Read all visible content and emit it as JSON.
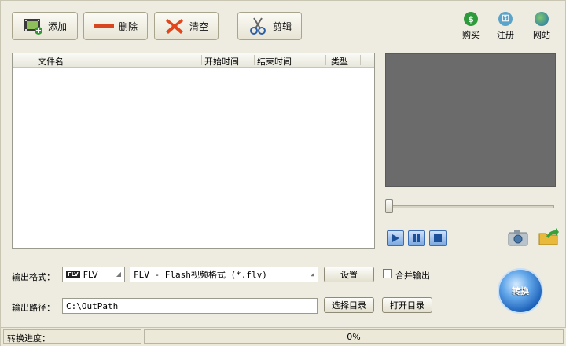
{
  "toolbar": {
    "add_label": "添加",
    "delete_label": "删除",
    "clear_label": "清空",
    "clip_label": "剪辑"
  },
  "top_right": {
    "buy_label": "购买",
    "register_label": "注册",
    "website_label": "网站"
  },
  "file_list": {
    "columns": [
      "文件名",
      "开始时间",
      "结束时间",
      "类型"
    ]
  },
  "output": {
    "format_label": "输出格式：",
    "format_short": "FLV",
    "format_desc": "FLV - Flash视频格式 (*.flv)",
    "settings_button": "设置",
    "merge_label": "合并输出",
    "path_label": "输出路径：",
    "path_value": "C:\\OutPath",
    "choose_dir_button": "选择目录",
    "open_dir_button": "打开目录"
  },
  "convert_button": "转换",
  "status": {
    "progress_label": "转换进度：",
    "progress_value": 0,
    "progress_text": "0%"
  },
  "colors": {
    "preview_bg": "#6b6b6b",
    "accent_blue": "#1b5fb8",
    "delete_red": "#d9451f"
  }
}
